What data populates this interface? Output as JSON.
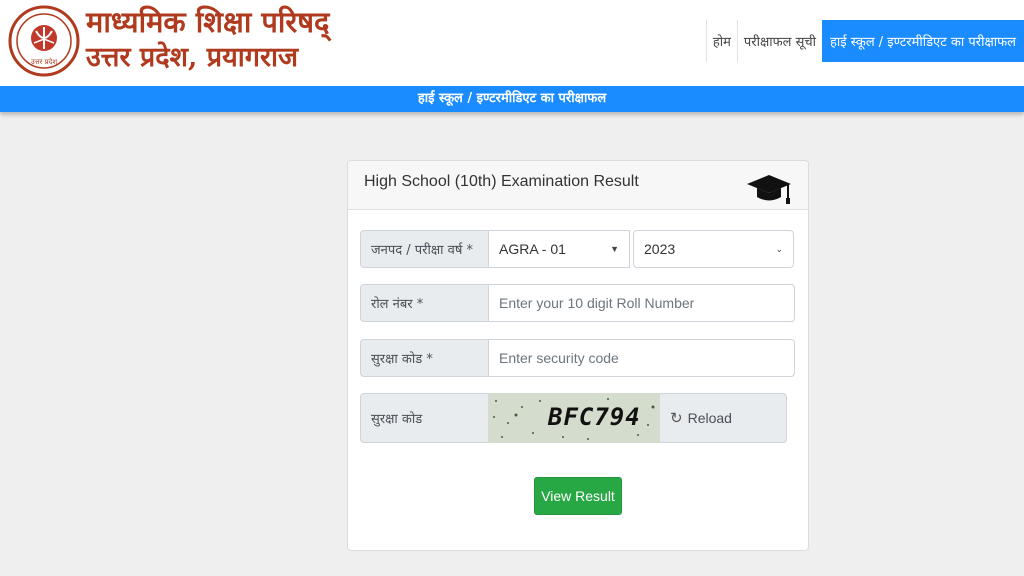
{
  "header": {
    "org_line1": "माध्यमिक शिक्षा परिषद्",
    "org_line2": "उत्तर प्रदेश, प्रयागराज",
    "logo_text": "उत्तर प्रदेश"
  },
  "nav": {
    "items": [
      {
        "label": "होम"
      },
      {
        "label": "परीक्षाफल सूची"
      },
      {
        "label": "हाई स्कूल / इण्टरमीडिएट का परीक्षाफल"
      }
    ]
  },
  "banner": {
    "title": "हाई स्कूल / इण्टरमीडिएट का परीक्षाफल"
  },
  "form": {
    "title": "High School (10th) Examination Result",
    "district_label": "जनपद / परीक्षा वर्ष *",
    "district_value": "AGRA - 01",
    "year_value": "2023",
    "roll_label": "रोल नंबर *",
    "roll_placeholder": "Enter your 10 digit Roll Number",
    "security_label": "सुरक्षा कोड *",
    "security_placeholder": "Enter security code",
    "captcha_label": "सुरक्षा कोड",
    "captcha_code": "BFC794",
    "reload_label": "Reload",
    "submit_label": "View Result"
  },
  "colors": {
    "primary": "#1a8cff",
    "brand": "#b03a1e",
    "success": "#28a745"
  },
  "icons": {
    "graduation": "graduation-cap-icon",
    "reload": "reload-icon",
    "select": "chevron-down-icon"
  }
}
